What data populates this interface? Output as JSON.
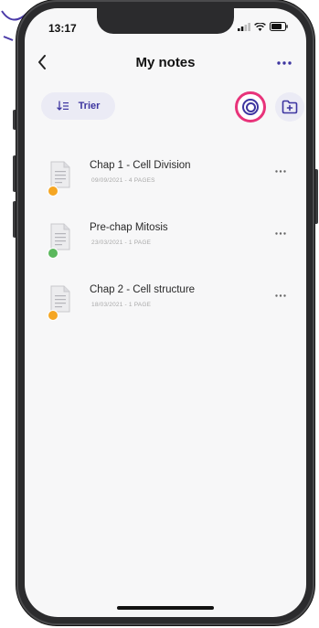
{
  "status_bar": {
    "time": "13:17",
    "icons": [
      "signal-icon",
      "wifi-icon",
      "battery-icon"
    ]
  },
  "nav": {
    "title": "My notes",
    "back_icon": "chevron-left-icon",
    "more_icon": "more-horizontal-icon"
  },
  "toolbar": {
    "sort_label": "Trier",
    "sort_icon": "sort-list-icon",
    "sync_icon": "sync-circle-icon",
    "new_folder_icon": "folder-plus-icon"
  },
  "notes": [
    {
      "title": "Chap 1 - Cell Division",
      "meta": "09/09/2021 - 4 PAGES",
      "status_color": "#f5a623"
    },
    {
      "title": "Pre-chap Mitosis",
      "meta": "23/03/2021 - 1 PAGE",
      "status_color": "#5bb85d"
    },
    {
      "title": "Chap 2 - Cell structure",
      "meta": "18/03/2021 - 1 PAGE",
      "status_color": "#f5a623"
    }
  ],
  "colors": {
    "accent": "#3d35a0",
    "highlight": "#e8337a",
    "chip_bg": "#ebebf5",
    "screen_bg": "#f7f7f8"
  }
}
